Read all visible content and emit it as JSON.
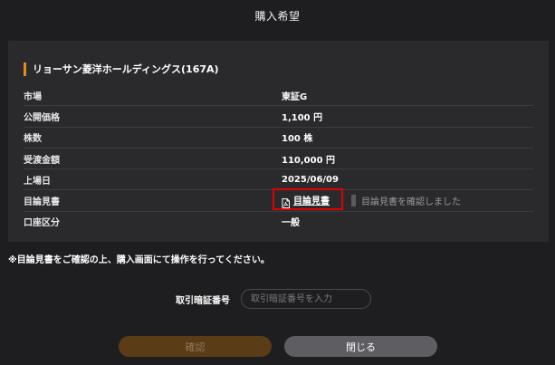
{
  "dialog": {
    "title": "購入希望"
  },
  "stock": {
    "name": "リョーサン菱洋ホールディングス(167A)"
  },
  "info_rows": [
    {
      "label": "市場",
      "value": "東証G"
    },
    {
      "label": "公開価格",
      "value": "1,100 円"
    },
    {
      "label": "株数",
      "value": "100 株"
    },
    {
      "label": "受渡金額",
      "value": "110,000 円"
    },
    {
      "label": "上場日",
      "value": "2025/06/09"
    },
    {
      "label": "目論見書",
      "link_text": "目論見書",
      "link_icon": "pdf-icon",
      "confirm_text": "目論見書を確認しました"
    },
    {
      "label": "口座区分",
      "value": "一般"
    }
  ],
  "notice": "※目論見書をご確認の上、購入画面にて操作を行ってください。",
  "pin": {
    "label": "取引暗証番号",
    "placeholder": "取引暗証番号を入力",
    "value": ""
  },
  "buttons": {
    "confirm_label": "確認",
    "close_label": "閉じる"
  },
  "colors": {
    "accent": "#e38a1c",
    "highlight_border": "#e00000",
    "confirm_button_disabled": "#5a3c17",
    "close_button": "#5e5e62"
  }
}
